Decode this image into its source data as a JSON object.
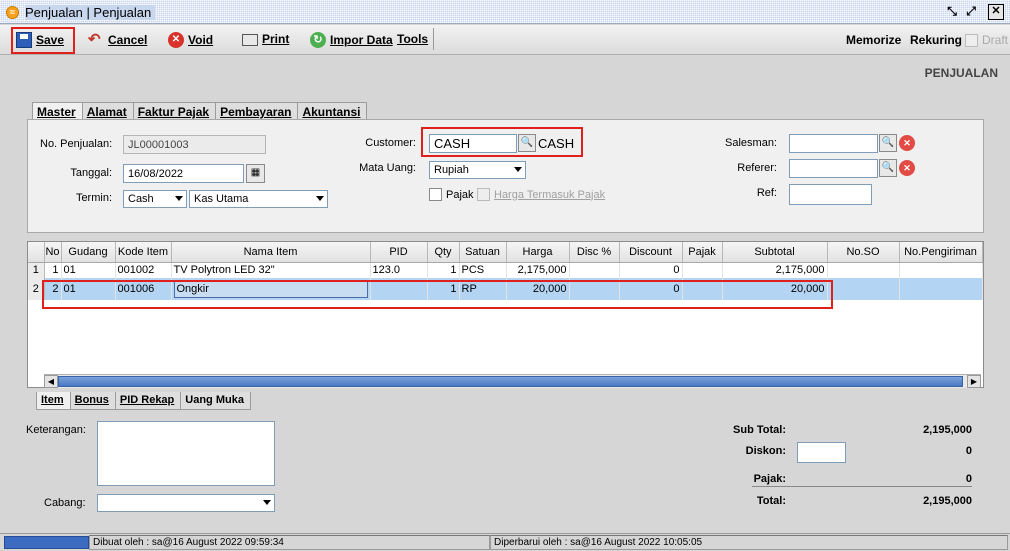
{
  "window": {
    "title": "Penjualan | Penjualan",
    "app_icon": "app-logo-icon",
    "controls": [
      "restore-icon",
      "maximize-icon",
      "close-icon"
    ]
  },
  "toolbar": {
    "save_label": "Save",
    "cancel_label": "Cancel",
    "void_label": "Void",
    "print_label": "Print",
    "import_label": "Impor Data",
    "tools_label": "Tools",
    "memorize_label": "Memorize",
    "rekuring_label": "Rekuring",
    "draft_label": "Draft"
  },
  "section_title": "PENJUALAN",
  "header_tabs": [
    {
      "label": "Master"
    },
    {
      "label": "Alamat"
    },
    {
      "label": "Faktur Pajak"
    },
    {
      "label": "Pembayaran"
    },
    {
      "label": "Akuntansi"
    }
  ],
  "form": {
    "no_label": "No. Penjualan:",
    "no_value": "JL00001003",
    "tanggal_label": "Tanggal:",
    "tanggal_value": "16/08/2022",
    "termin_label": "Termin:",
    "termin_value": "Cash",
    "kas_value": "Kas Utama",
    "customer_label": "Customer:",
    "customer_code": "CASH",
    "customer_name": "CASH",
    "mata_uang_label": "Mata Uang:",
    "mata_uang_value": "Rupiah",
    "pajak_label": "Pajak",
    "harga_pajak_label": "Harga Termasuk Pajak",
    "salesman_label": "Salesman:",
    "referer_label": "Referer:",
    "ref_label": "Ref:"
  },
  "grid": {
    "columns": [
      "No",
      "Gudang",
      "Kode Item",
      "Nama Item",
      "PID",
      "Qty",
      "Satuan",
      "Harga",
      "Disc %",
      "Discount",
      "Pajak",
      "Subtotal",
      "No.SO",
      "No.Pengiriman"
    ],
    "rows": [
      {
        "rownum": "1",
        "no": "1",
        "gudang": "01",
        "kode": "001002",
        "nama": "TV Polytron LED 32\"",
        "pid": "123.0",
        "qty": "1",
        "satuan": "PCS",
        "harga": "2,175,000",
        "disc": "",
        "discount": "0",
        "pajak": "",
        "subtotal": "2,175,000",
        "so": "",
        "kirim": ""
      },
      {
        "rownum": "2",
        "no": "2",
        "gudang": "01",
        "kode": "001006",
        "nama": "Ongkir",
        "pid": "",
        "qty": "1",
        "satuan": "RP",
        "harga": "20,000",
        "disc": "",
        "discount": "0",
        "pajak": "",
        "subtotal": "20,000",
        "so": "",
        "kirim": ""
      }
    ]
  },
  "bottom_tabs": [
    {
      "label": "Item"
    },
    {
      "label": "Bonus"
    },
    {
      "label": "PID Rekap"
    },
    {
      "label": "Uang Muka"
    }
  ],
  "footer": {
    "keterangan_label": "Keterangan:",
    "cabang_label": "Cabang:",
    "subtotal_label": "Sub Total:",
    "subtotal_value": "2,195,000",
    "diskon_label": "Diskon:",
    "diskon_value": "0",
    "pajak_label": "Pajak:",
    "pajak_value": "0",
    "total_label": "Total:",
    "total_value": "2,195,000"
  },
  "status": {
    "dibuat": "Dibuat oleh : sa@16 August 2022  09:59:34",
    "diperbarui": "Diperbarui oleh : sa@16 August 2022  10:05:05"
  },
  "colors": {
    "highlight_box": "#e0201c",
    "selected_row": "#b4d4f4",
    "status_blue": "#3c6bc2"
  }
}
